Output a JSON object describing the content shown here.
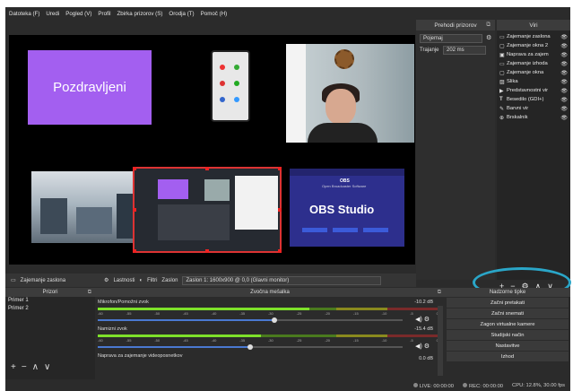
{
  "menu": [
    "Datoteka (F)",
    "Uredi",
    "Pogled (V)",
    "Profil",
    "Zbirka prizorov (S)",
    "Orodja (T)",
    "Pomoč (H)"
  ],
  "preview": {
    "slide_text": "Pozdravljeni",
    "obs_title": "OBS Studio",
    "obs_header": "OBS",
    "obs_sub": "Open Broadcaster Software"
  },
  "toolbar": {
    "source_label": "Zajemanje zaslona",
    "properties": "Lastnosti",
    "filters": "Filtri",
    "screen_label": "Zaslon",
    "screen_value": "Zaslon 1: 1600x900 @ 0,0 (Glavni monitor)"
  },
  "transitions": {
    "title": "Prehodi prizorov",
    "selected": "Pojemaj",
    "duration_label": "Trajanje",
    "duration_value": "202 ms"
  },
  "sources": {
    "title": "Viri",
    "items": [
      {
        "icon": "monitor-icon",
        "label": "Zajemanje zaslona"
      },
      {
        "icon": "window-icon",
        "label": "Zajemanje okna 2"
      },
      {
        "icon": "camera-icon",
        "label": "Naprava za zajem"
      },
      {
        "icon": "monitor-icon",
        "label": "Zajemanje izhoda"
      },
      {
        "icon": "window-icon",
        "label": "Zajemanje okna"
      },
      {
        "icon": "image-icon",
        "label": "Slika"
      },
      {
        "icon": "play-icon",
        "label": "Predstavnostni vir"
      },
      {
        "icon": "text-icon",
        "label": "Besedilo (GDI+)"
      },
      {
        "icon": "brush-icon",
        "label": "Barvni vir"
      },
      {
        "icon": "globe-icon",
        "label": "Brskalnik"
      }
    ],
    "buttons": [
      "+",
      "−",
      "⚙",
      "∧",
      "∨"
    ]
  },
  "scenes": {
    "title": "Prizori",
    "items": [
      "Primer 1",
      "Primer 2"
    ],
    "buttons": [
      "+",
      "−",
      "∧",
      "∨"
    ]
  },
  "mixer": {
    "title": "Zvočna mešalka",
    "channels": [
      {
        "name": "Mikrofon/Pomožni zvok",
        "db": "-10.2 dB",
        "level": 0.62,
        "volume": 0.58
      },
      {
        "name": "Namizni zvok",
        "db": "-15.4 dB",
        "level": 0.48,
        "volume": 0.5
      },
      {
        "name": "Naprava za zajemanje videoposnetkov",
        "db": "0.0 dB",
        "level": 0.0,
        "volume": 1.0
      }
    ],
    "ticks": [
      "-60",
      "-55",
      "-50",
      "-45",
      "-40",
      "-35",
      "-30",
      "-25",
      "-20",
      "-15",
      "-10",
      "-5",
      "0"
    ]
  },
  "controls": {
    "title": "Nadzorne tipke",
    "buttons": [
      "Začni pretakati",
      "Začni snemati",
      "Zagon virtualne kamere",
      "Studijski način",
      "Nastavitve",
      "Izhod"
    ]
  },
  "status": {
    "live": "LIVE: 00:00:00",
    "rec": "REC: 00:00:00",
    "cpu": "CPU: 12.8%, 30.00 fps"
  },
  "colors": {
    "accent_circle": "#2aa6c8",
    "slide_bg": "#a35ff0",
    "obs_bg": "#2d2f8d"
  }
}
